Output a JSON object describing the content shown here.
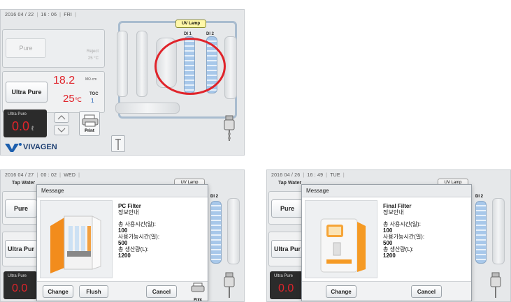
{
  "screen1": {
    "status": {
      "date": "2016 04 / 22",
      "time": "16 : 06",
      "day": "FRI"
    },
    "pure_label": "Pure",
    "pure_meta": "25 °C",
    "pure_reject": "Reject",
    "ultra_pure_label": "Ultra Pure",
    "resistivity": "18.2",
    "resistivity_unit": "MΩ·cm",
    "temp": "25",
    "temp_unit": "℃",
    "toc_label": "TOC",
    "toc_value": "1",
    "dispense_label": "Ultra Pure",
    "volume": "0.0",
    "volume_unit": "ℓ",
    "print_label": "Print",
    "uv_lamp": "UV Lamp",
    "di1": "DI 1",
    "di2": "DI 2",
    "brand": "VIVAGEN",
    "highlight_color": "#e0242b"
  },
  "screen2": {
    "status": {
      "date": "2016 04 / 27",
      "time": "00 : 02",
      "day": "WED"
    },
    "tap_water": "Tap Water",
    "bg_pure": "Pure",
    "bg_ultra": "Ultra Pur",
    "bg_dispense": "Ultra Pure",
    "bg_volume": "0.0",
    "uv_lamp": "UV Lamp",
    "di2": "DI 2",
    "modal_title": "Message",
    "filter_name": "PC Filter",
    "info_title": "정보안내",
    "total_use_label": "총 사용시간(일):",
    "total_use_value": "100",
    "available_label": "사용가능시간(일):",
    "available_value": "500",
    "production_label": "총 생산량(L):",
    "production_value": "1200",
    "btn_change": "Change",
    "btn_flush": "Flush",
    "btn_cancel": "Cancel",
    "print_label": "Print"
  },
  "screen3": {
    "status": {
      "date": "2016 04 / 26",
      "time": "16 : 49",
      "day": "TUE"
    },
    "tap_water": "Tap Water",
    "bg_pure": "Pure",
    "bg_ultra": "Ultra Pur",
    "bg_dispense": "Ultra Pure",
    "bg_volume": "0.0",
    "uv_lamp": "UV Lamp",
    "di2": "DI 2",
    "modal_title": "Message",
    "filter_name": "Final Filter",
    "info_title": "정보안내",
    "total_use_label": "총 사용시간(일):",
    "total_use_value": "100",
    "available_label": "사용가능시간(일):",
    "available_value": "500",
    "production_label": "총 생산량(L):",
    "production_value": "1200",
    "btn_change": "Change",
    "btn_cancel": "Cancel"
  }
}
